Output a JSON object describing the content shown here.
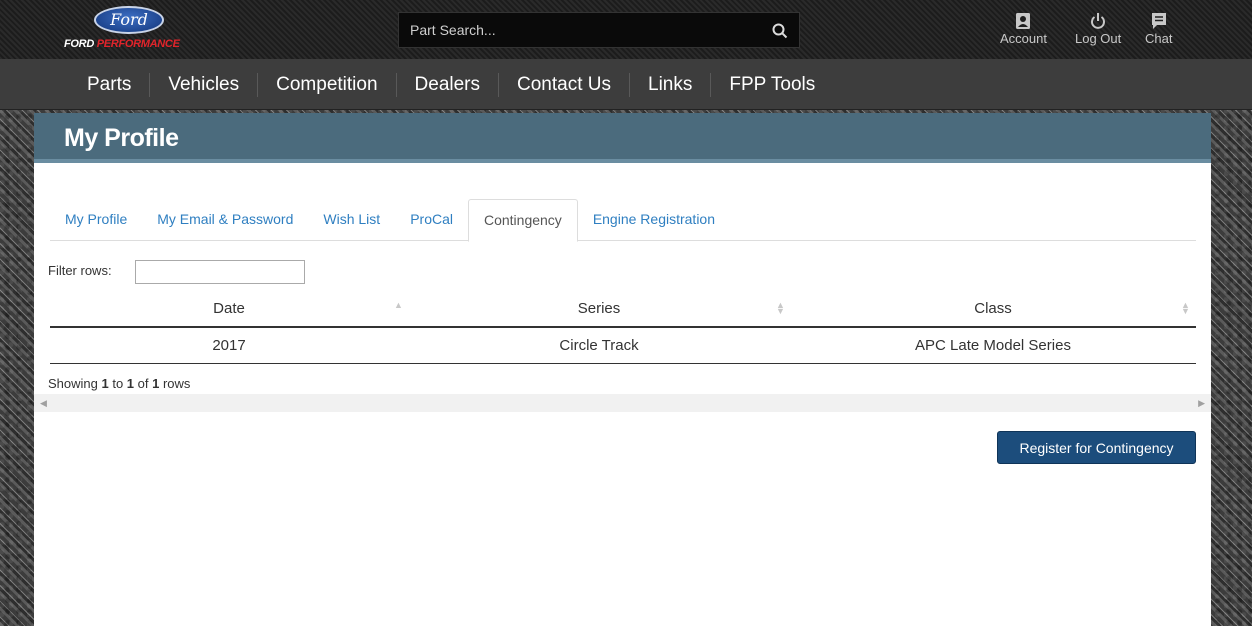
{
  "header": {
    "logo_text": "Ford",
    "logo_sub_prefix": "FORD ",
    "logo_sub_accent": "PERFORMANCE",
    "search_placeholder": "Part Search...",
    "account_label": "Account",
    "logout_label": "Log Out",
    "chat_label": "Chat"
  },
  "nav": {
    "items": [
      "Parts",
      "Vehicles",
      "Competition",
      "Dealers",
      "Contact Us",
      "Links",
      "FPP Tools"
    ]
  },
  "panel": {
    "title": "My Profile",
    "tabs": [
      {
        "label": "My Profile",
        "active": false
      },
      {
        "label": "My Email & Password",
        "active": false
      },
      {
        "label": "Wish List",
        "active": false
      },
      {
        "label": "ProCal",
        "active": false
      },
      {
        "label": "Contingency",
        "active": true
      },
      {
        "label": "Engine Registration",
        "active": false
      }
    ],
    "filter_label": "Filter rows:",
    "filter_value": "",
    "table": {
      "columns": [
        "Date",
        "Series",
        "Class"
      ],
      "rows": [
        [
          "2017",
          "Circle Track",
          "APC Late Model Series"
        ]
      ]
    },
    "showing": {
      "prefix": "Showing ",
      "from": "1",
      "to_word": " to ",
      "to": "1",
      "of_word": " of ",
      "total": "1",
      "suffix": " rows"
    },
    "register_button": "Register for Contingency"
  },
  "colors": {
    "panel_header": "#4b6b7d",
    "tab_link": "#2f7fc1",
    "button": "#1c4d7c",
    "nav_bg": "#3d3d3d"
  }
}
